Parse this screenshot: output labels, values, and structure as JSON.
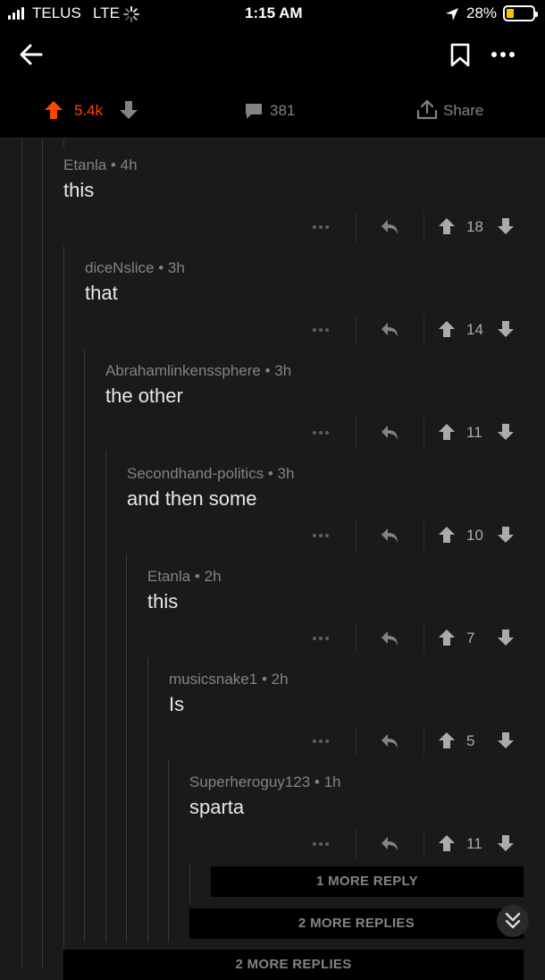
{
  "status_bar": {
    "carrier": "TELUS",
    "network": "LTE",
    "time": "1:15 AM",
    "battery": "28%"
  },
  "post_actions": {
    "upvotes": "5.4k",
    "comments": "381",
    "share_label": "Share",
    "upvote_color": "#ff4500"
  },
  "comments": [
    {
      "author": "Etanla",
      "age": "4h",
      "body": "this",
      "score": "18"
    },
    {
      "author": "diceNslice",
      "age": "3h",
      "body": "that",
      "score": "14"
    },
    {
      "author": "Abrahamlinkenssphere",
      "age": "3h",
      "body": "the other",
      "score": "11"
    },
    {
      "author": "Secondhand-politics",
      "age": "3h",
      "body": "and then some",
      "score": "10"
    },
    {
      "author": "Etanla",
      "age": "2h",
      "body": "this",
      "score": "7"
    },
    {
      "author": "musicsnake1",
      "age": "2h",
      "body": "Is",
      "score": "5"
    },
    {
      "author": "Superheroguy123",
      "age": "1h",
      "body": "sparta",
      "score": "11"
    }
  ],
  "more_replies": {
    "level7": "1 MORE REPLY",
    "level6": "2 MORE REPLIES",
    "level1": "2 MORE REPLIES"
  },
  "icons": {
    "back": "back-arrow-icon",
    "save": "bookmark-icon",
    "more": "more-options-icon",
    "collapse": "collapse-thread-icon"
  }
}
